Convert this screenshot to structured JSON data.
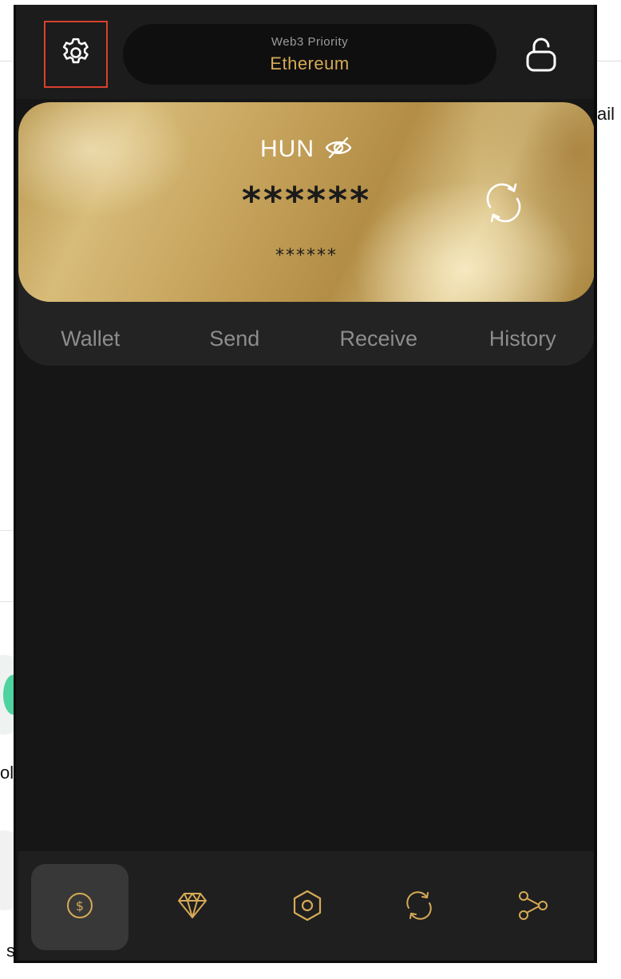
{
  "header": {
    "network_label": "Web3 Priority",
    "network_name": "Ethereum"
  },
  "card": {
    "currency": "HUN",
    "balance_masked": "******",
    "sub_balance_masked": "******"
  },
  "tabs": [
    {
      "label": "Wallet"
    },
    {
      "label": "Send"
    },
    {
      "label": "Receive"
    },
    {
      "label": "History"
    }
  ],
  "bottom_nav": [
    {
      "icon": "dollar-coin-icon",
      "active": true
    },
    {
      "icon": "diamond-icon",
      "active": false
    },
    {
      "icon": "hexagon-nut-icon",
      "active": false
    },
    {
      "icon": "sync-icon",
      "active": false
    },
    {
      "icon": "share-nodes-icon",
      "active": false
    }
  ],
  "background_page": {
    "text_right": "ail",
    "text_left_1": "ol",
    "text_left_2": "s"
  },
  "colors": {
    "accent_gold": "#d6aa56",
    "popup_bg": "#161616",
    "highlight_border": "#d8412c"
  }
}
